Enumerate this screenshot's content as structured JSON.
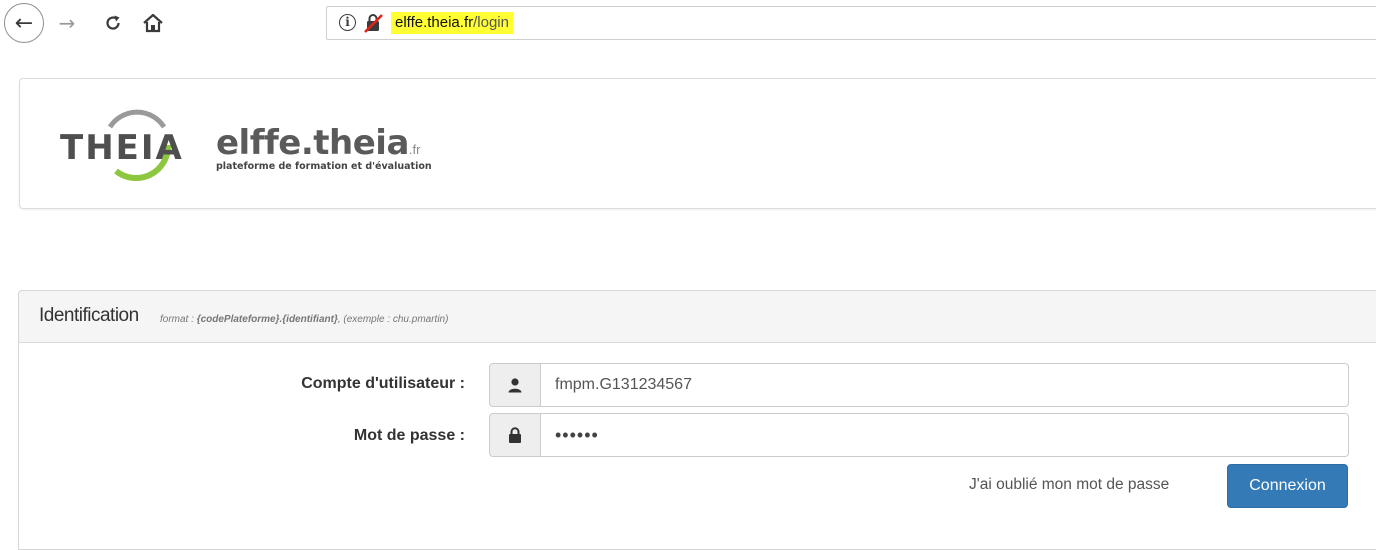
{
  "browser": {
    "back_glyph": "←",
    "forward_glyph": "→",
    "reload_glyph": "C",
    "url_host": "elffe.theia.fr",
    "url_path": "/login",
    "info_glyph": "i"
  },
  "header": {
    "logo_text": "THEIA",
    "brand_name": "elffe.theia",
    "brand_tld": ".fr",
    "tagline": "plateforme de formation et d'évaluation",
    "logo_arc_color": "#8dc63f"
  },
  "login": {
    "title": "Identification",
    "hint_prefix": "format : ",
    "hint_format": "{codePlateforme}.{identifiant}",
    "hint_example": ", (exemple : chu.pmartin)",
    "username_label": "Compte d'utilisateur :",
    "username_value": "fmpm.G131234567",
    "password_label": "Mot de passe :",
    "password_value": "••••••",
    "forgot_link": "J'ai oublié mon mot de passe",
    "submit_label": "Connexion",
    "accent_color": "#337ab7"
  }
}
